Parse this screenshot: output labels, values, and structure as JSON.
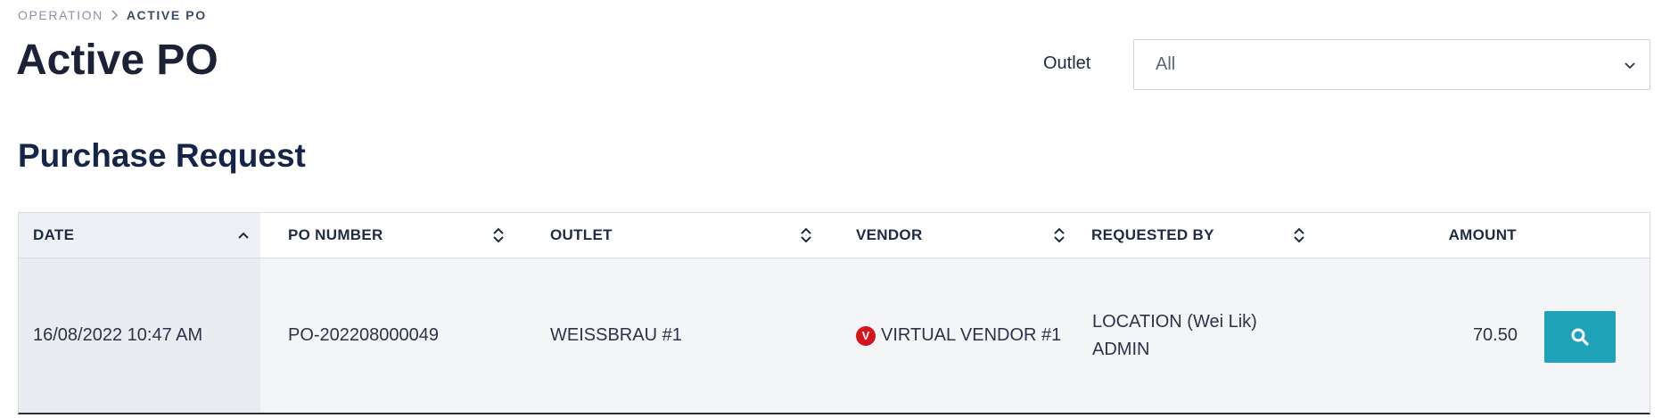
{
  "breadcrumb": {
    "parent": "OPERATION",
    "current": "ACTIVE PO"
  },
  "page_title": "Active PO",
  "filter": {
    "outlet_label": "Outlet",
    "outlet_value": "All"
  },
  "section_title": "Purchase Request",
  "table": {
    "columns": {
      "date": "DATE",
      "po_number": "PO NUMBER",
      "outlet": "OUTLET",
      "vendor": "VENDOR",
      "requested_by": "REQUESTED BY",
      "amount": "AMOUNT"
    },
    "sorted_column": "date",
    "sort_direction": "ascending",
    "rows": [
      {
        "date": "16/08/2022 10:47 AM",
        "po_number": "PO-202208000049",
        "outlet": "WEISSBRAU #1",
        "vendor_badge": "V",
        "vendor": "VIRTUAL VENDOR #1",
        "requested_by_line1": "LOCATION (Wei Lik)",
        "requested_by_line2": "ADMIN",
        "amount": "70.50",
        "action_icon": "search-icon"
      }
    ]
  },
  "colors": {
    "accent": "#1fa3b8",
    "vendor_badge": "#d6141d",
    "title": "#1b2236",
    "section_title": "#152549"
  }
}
